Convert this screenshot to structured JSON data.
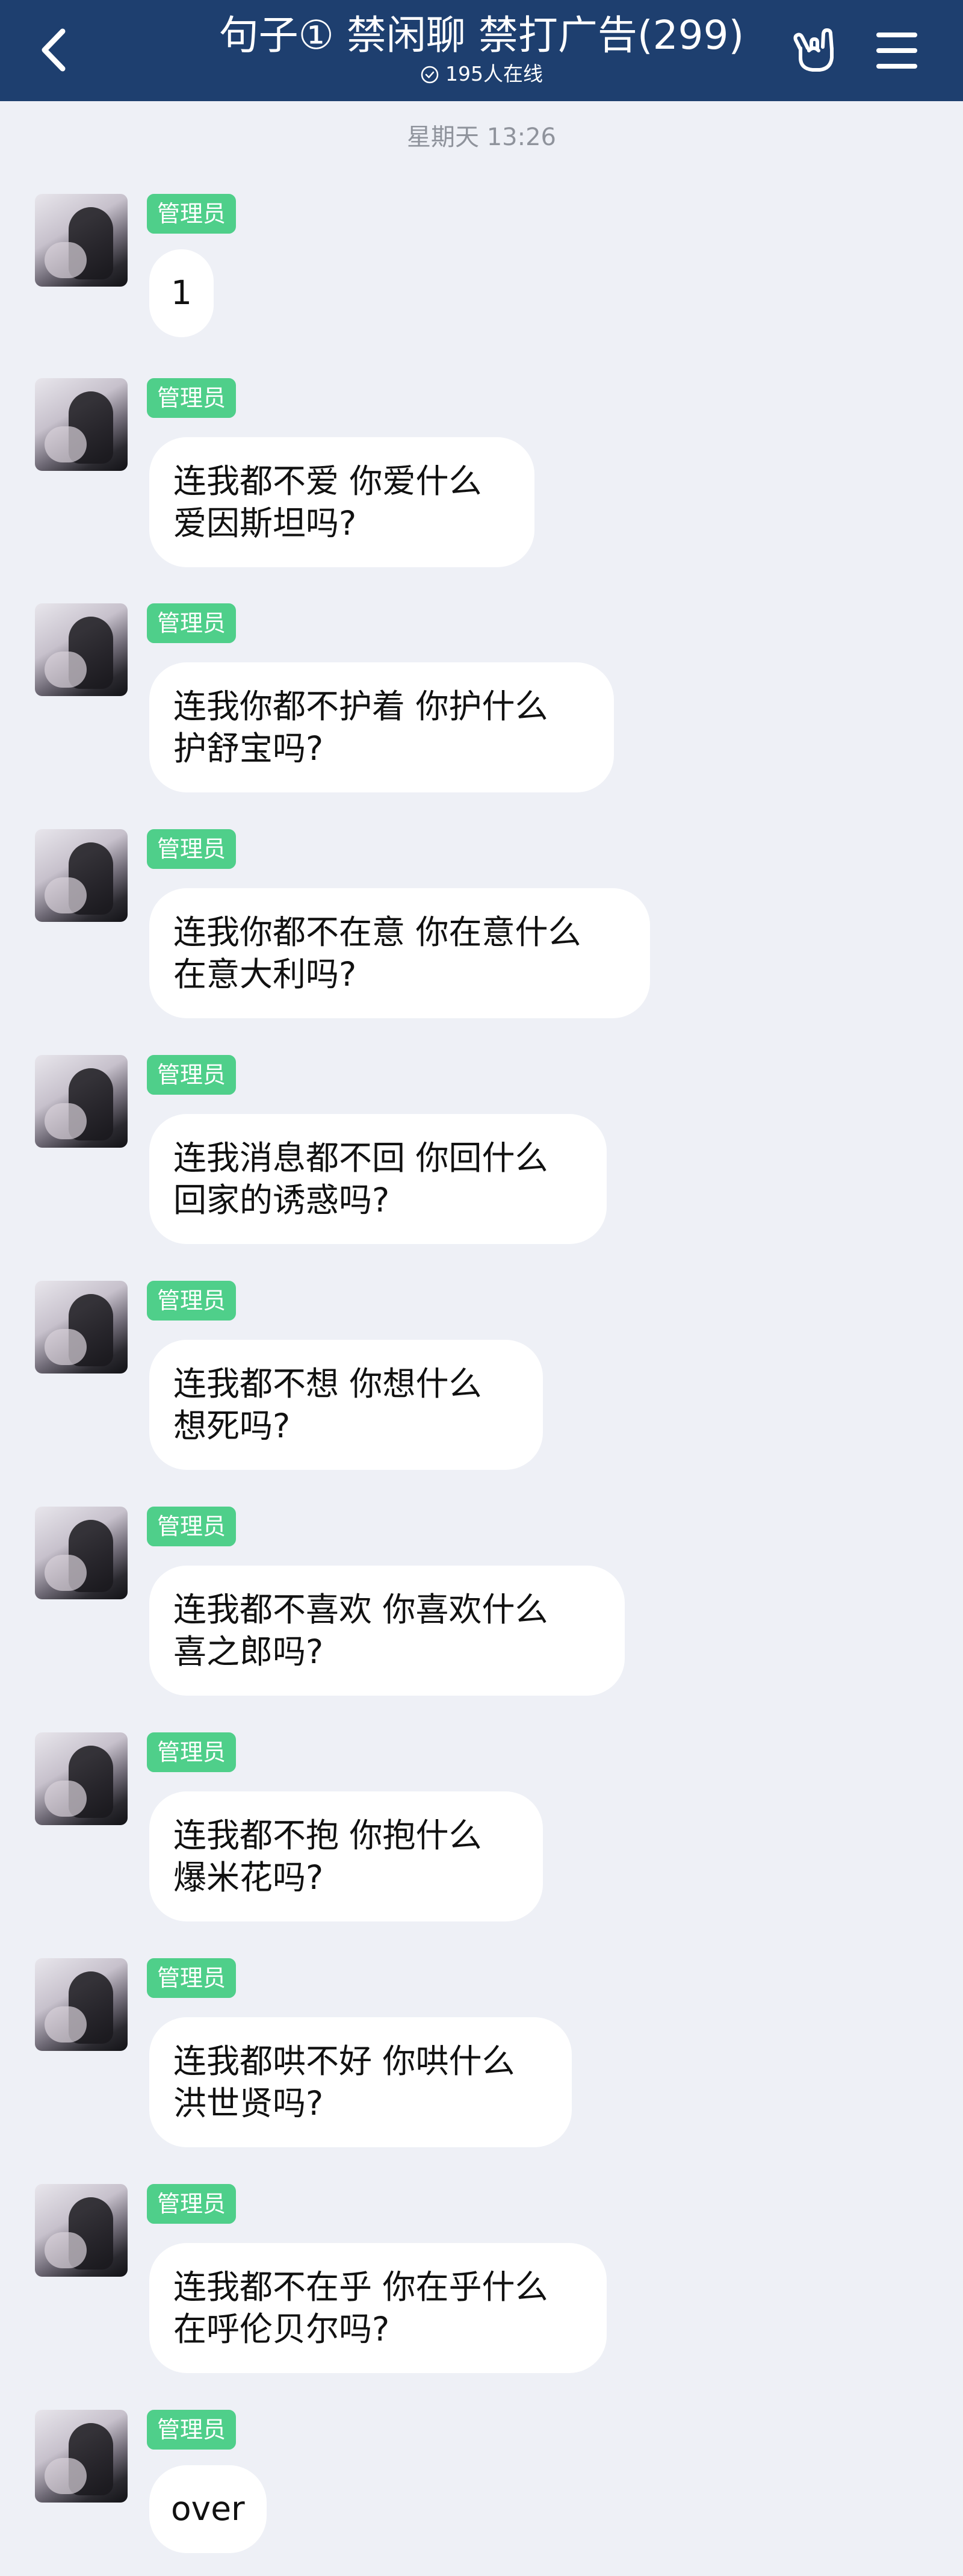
{
  "header": {
    "title": "句子① 禁闲聊 禁打广告(299)",
    "online_text": "195人在线",
    "background_color": "#1e3f6f",
    "icons": {
      "back": "chevron-left-icon",
      "group": "rock-hand-icon",
      "menu": "hamburger-menu-icon",
      "online": "check-circle-icon"
    }
  },
  "chat": {
    "timestamp": "星期天 13:26",
    "messages": [
      {
        "role_badge": "管理员",
        "lines": [
          "1"
        ]
      },
      {
        "role_badge": "管理员",
        "lines": [
          "连我都不爱  你爱什么",
          "爱因斯坦吗?"
        ]
      },
      {
        "role_badge": "管理员",
        "lines": [
          "连我你都不护着   你护什么",
          "护舒宝吗?"
        ]
      },
      {
        "role_badge": "管理员",
        "lines": [
          "连我你都不在意   你在意什么",
          "在意大利吗?"
        ]
      },
      {
        "role_badge": "管理员",
        "lines": [
          "连我消息都不回  你回什么",
          "回家的诱惑吗?"
        ]
      },
      {
        "role_badge": "管理员",
        "lines": [
          "连我都不想   你想什么",
          "想死吗?"
        ]
      },
      {
        "role_badge": "管理员",
        "lines": [
          "连我都不喜欢  你喜欢什么",
          "喜之郎吗?"
        ]
      },
      {
        "role_badge": "管理员",
        "lines": [
          "连我都不抱   你抱什么",
          "爆米花吗?"
        ]
      },
      {
        "role_badge": "管理员",
        "lines": [
          "连我都哄不好  你哄什么",
          "洪世贤吗?"
        ]
      },
      {
        "role_badge": "管理员",
        "lines": [
          "连我都不在乎  你在乎什么",
          "在呼伦贝尔吗?"
        ]
      },
      {
        "role_badge": "管理员",
        "lines": [
          "over"
        ]
      }
    ]
  },
  "colors": {
    "badge": "#4fcf8a",
    "page_background": "#eef0f6",
    "bubble": "#ffffff"
  }
}
